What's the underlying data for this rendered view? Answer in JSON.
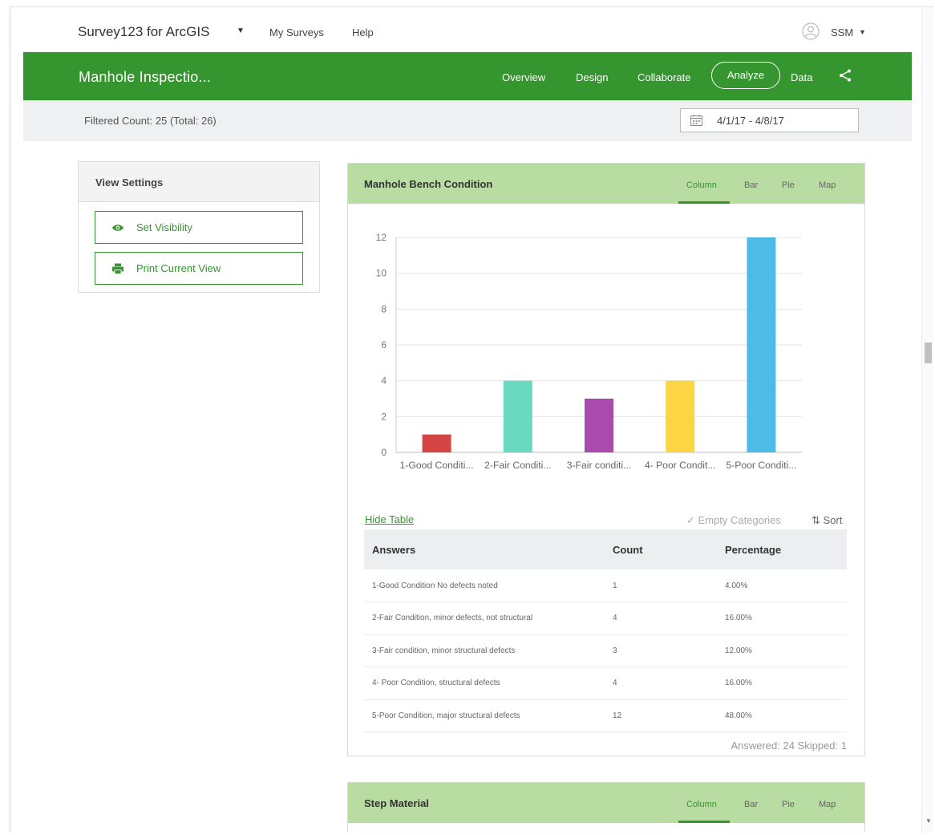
{
  "topnav": {
    "brand": "Survey123 for ArcGIS",
    "links": [
      "My Surveys",
      "Help"
    ],
    "user": "SSM"
  },
  "header": {
    "survey_title": "Manhole Inspectio...",
    "tabs": [
      "Overview",
      "Design",
      "Collaborate",
      "Analyze",
      "Data"
    ],
    "active_tab": "Analyze"
  },
  "filter": {
    "count_text": "Filtered Count: 25 (Total: 26)",
    "date_range": "4/1/17 - 4/8/17"
  },
  "view_settings": {
    "title": "View Settings",
    "buttons": [
      "Set Visibility",
      "Print Current View"
    ]
  },
  "question1": {
    "title": "Manhole Bench Condition",
    "chart_tabs": [
      "Column",
      "Bar",
      "Pie",
      "Map"
    ],
    "active_chart_tab": "Column",
    "hide_table": "Hide Table",
    "empty_categories": "Empty Categories",
    "sort": "Sort",
    "table": {
      "headers": [
        "Answers",
        "Count",
        "Percentage"
      ],
      "rows": [
        [
          "1-Good Condition No defects noted",
          "1",
          "4.00%"
        ],
        [
          "2-Fair Condition, minor defects, not structural",
          "4",
          "16.00%"
        ],
        [
          "3-Fair condition, minor structural defects",
          "3",
          "12.00%"
        ],
        [
          "4- Poor Condition, structural defects",
          "4",
          "16.00%"
        ],
        [
          "5-Poor Condition, major structural defects",
          "12",
          "48.00%"
        ]
      ]
    },
    "answered_text": "Answered: 24  Skipped: 1"
  },
  "question2": {
    "title": "Step Material",
    "chart_tabs": [
      "Column",
      "Bar",
      "Pie",
      "Map"
    ],
    "active_chart_tab": "Column"
  },
  "chart_data": {
    "type": "bar",
    "categories": [
      "1-Good Conditi...",
      "2-Fair Conditi...",
      "3-Fair conditi...",
      "4- Poor Condit...",
      "5-Poor Conditi..."
    ],
    "values": [
      1,
      4,
      3,
      4,
      12
    ],
    "colors": [
      "#d64545",
      "#69d9c0",
      "#a94bad",
      "#fdd444",
      "#4dbbe5"
    ],
    "ylim": [
      0,
      12
    ],
    "yticks": [
      0,
      2,
      4,
      6,
      8,
      10,
      12
    ],
    "grid": true
  }
}
